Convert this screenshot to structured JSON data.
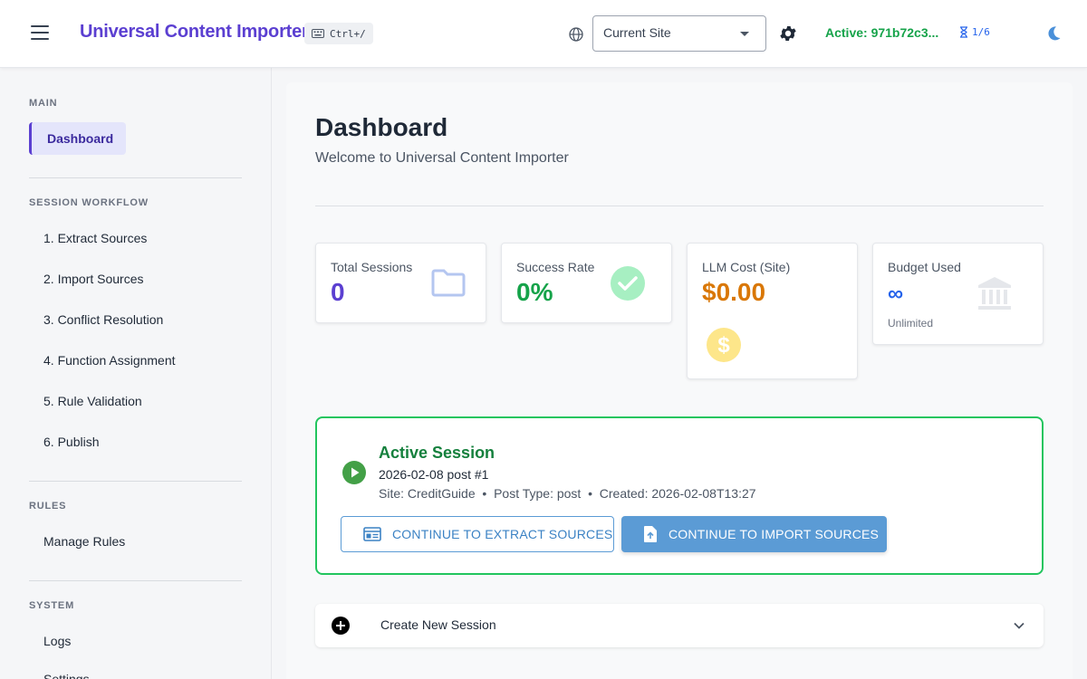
{
  "header": {
    "title": "Universal Content Importer",
    "shortcut": "Ctrl+/",
    "site_select": "Current Site",
    "active_status": "Active: 971b72c3...",
    "counter": "1/6"
  },
  "sidebar": {
    "sections": [
      {
        "title": "MAIN",
        "items": [
          {
            "label": "Dashboard",
            "active": true
          }
        ]
      },
      {
        "title": "SESSION WORKFLOW",
        "items": [
          {
            "label": "1. Extract Sources"
          },
          {
            "label": "2. Import Sources"
          },
          {
            "label": "3. Conflict Resolution"
          },
          {
            "label": "4. Function Assignment"
          },
          {
            "label": "5. Rule Validation"
          },
          {
            "label": "6. Publish"
          }
        ]
      },
      {
        "title": "RULES",
        "items": [
          {
            "label": "Manage Rules"
          }
        ]
      },
      {
        "title": "SYSTEM",
        "items": [
          {
            "label": "Logs"
          },
          {
            "label": "Settings"
          }
        ]
      }
    ]
  },
  "main": {
    "title": "Dashboard",
    "subtitle": "Welcome to Universal Content Importer",
    "stats": [
      {
        "label": "Total Sessions",
        "value": "0",
        "color": "#5b3fd1",
        "icon": "folder-icon"
      },
      {
        "label": "Success Rate",
        "value": "0%",
        "color": "#16a34a",
        "icon": "check-circle-icon"
      },
      {
        "label": "LLM Cost (Site)",
        "value": "$0.00",
        "color": "#d97706",
        "icon": "dollar-icon"
      },
      {
        "label": "Budget Used",
        "value": "∞",
        "sub": "Unlimited",
        "color": "#2563eb",
        "icon": "bank-icon"
      }
    ],
    "session": {
      "heading": "Active Session",
      "name": "2026-02-08 post #1",
      "meta": "Site: CreditGuide  •  Post Type: post  •  Created: 2026-02-08T13:27",
      "btn_extract": "CONTINUE TO EXTRACT SOURCES",
      "btn_import": "CONTINUE TO IMPORT SOURCES"
    },
    "create_label": "Create New Session"
  }
}
